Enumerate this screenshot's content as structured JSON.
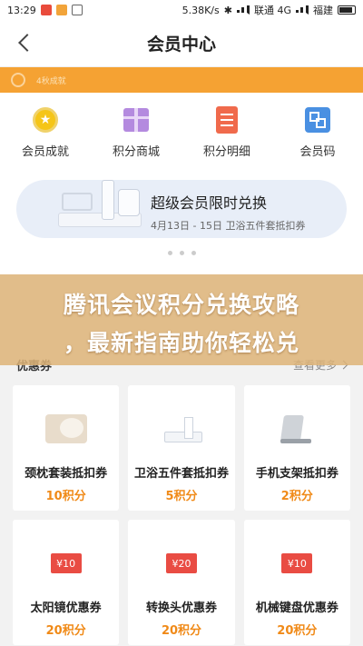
{
  "status_bar": {
    "time": "13:29",
    "speed": "5.38K/s",
    "carrier1": "联通 4G",
    "carrier2": "福建"
  },
  "header": {
    "title": "会员中心"
  },
  "level_strip": {
    "text": "4秋成就"
  },
  "menu": [
    {
      "label": "会员成就",
      "icon": "medal-icon"
    },
    {
      "label": "积分商城",
      "icon": "gift-icon"
    },
    {
      "label": "积分明细",
      "icon": "document-icon"
    },
    {
      "label": "会员码",
      "icon": "qrcode-icon"
    }
  ],
  "banner": {
    "title": "超级会员限时兑换",
    "subtitle": "4月13日 - 15日 卫浴五件套抵扣券"
  },
  "overlay": {
    "line1": "腾讯会议积分兑换攻略",
    "line2": "，最新指南助你轻松兑"
  },
  "section": {
    "title": "优惠券",
    "more": "查看更多"
  },
  "products": [
    {
      "name": "颈枕套装抵扣券",
      "points": "10积分",
      "image": "pillow"
    },
    {
      "name": "卫浴五件套抵扣券",
      "points": "5积分",
      "image": "bath-set"
    },
    {
      "name": "手机支架抵扣券",
      "points": "2积分",
      "image": "phone-stand"
    },
    {
      "name": "太阳镜优惠券",
      "points": "20积分",
      "image": "coupon",
      "coupon_text": "¥10"
    },
    {
      "name": "转换头优惠券",
      "points": "20积分",
      "image": "coupon",
      "coupon_text": "¥20"
    },
    {
      "name": "机械键盘优惠券",
      "points": "20积分",
      "image": "coupon",
      "coupon_text": "¥10"
    }
  ]
}
